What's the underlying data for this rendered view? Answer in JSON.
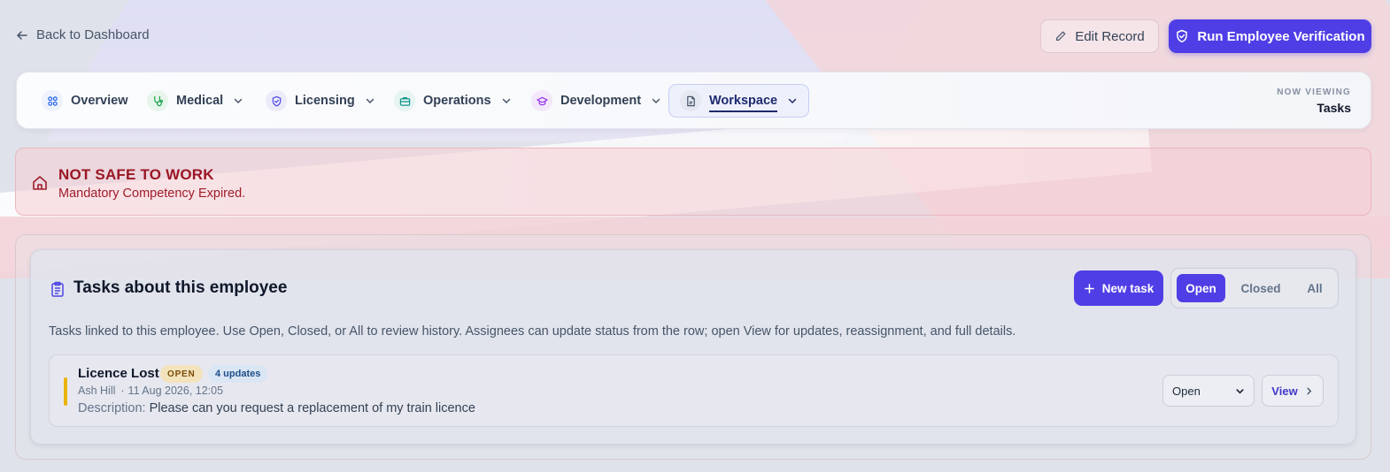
{
  "topbar": {
    "back_label": "Back to Dashboard",
    "edit_label": "Edit Record",
    "run_label": "Run Employee Verification"
  },
  "nav": {
    "tabs": [
      {
        "label": "Overview",
        "icon": "grid-icon",
        "color": "#2563eb"
      },
      {
        "label": "Medical",
        "icon": "stethoscope-icon",
        "color": "#16a34a"
      },
      {
        "label": "Licensing",
        "icon": "shield-icon",
        "color": "#4f46e5"
      },
      {
        "label": "Operations",
        "icon": "briefcase-icon",
        "color": "#0d9488"
      },
      {
        "label": "Development",
        "icon": "graduation-cap-icon",
        "color": "#9333ea"
      },
      {
        "label": "Workspace",
        "icon": "document-icon",
        "color": "#475569"
      }
    ],
    "now_viewing_key": "NOW VIEWING",
    "now_viewing_value": "Tasks"
  },
  "alert": {
    "title": "NOT SAFE TO WORK",
    "subtitle": "Mandatory Competency Expired."
  },
  "tasks": {
    "heading": "Tasks about this employee",
    "new_task_label": "New task",
    "filters": [
      "Open",
      "Closed",
      "All"
    ],
    "active_filter": "Open",
    "description": "Tasks linked to this employee. Use Open, Closed, or All to review history. Assignees can update status from the row; open View for updates, reassignment, and full details.",
    "items": [
      {
        "title": "Licence Lost",
        "status_badge": "OPEN",
        "updates_badge": "4 updates",
        "assignee": "Ash Hill",
        "dot": "·",
        "timestamp": "11 Aug 2026, 12:05",
        "description_label": "Description:",
        "description": "Please can you request a replacement of my train licence",
        "status_value": "Open",
        "view_label": "View"
      }
    ]
  },
  "colors": {
    "accent": "#4f3ee6",
    "alert_text": "#9b1624",
    "pending_bar": "#eab308"
  }
}
